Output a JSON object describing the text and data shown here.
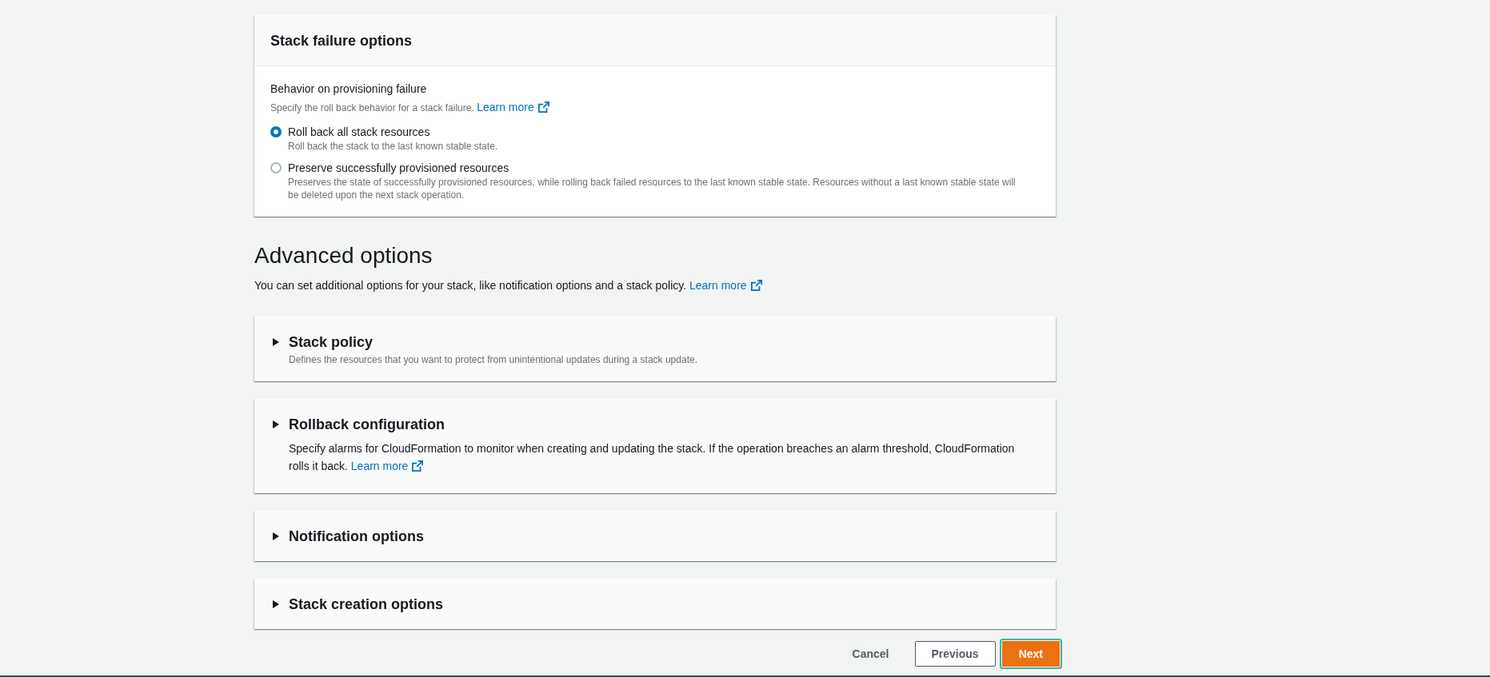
{
  "stack_failure_options": {
    "title": "Stack failure options",
    "field_label": "Behavior on provisioning failure",
    "field_description": "Specify the roll back behavior for a stack failure.",
    "learn_more": "Learn more",
    "options": [
      {
        "label": "Roll back all stack resources",
        "description": "Roll back the stack to the last known stable state.",
        "selected": true
      },
      {
        "label": "Preserve successfully provisioned resources",
        "description": "Preserves the state of successfully provisioned resources, while rolling back failed resources to the last known stable state. Resources without a last known stable state will be deleted upon the next stack operation.",
        "selected": false
      }
    ]
  },
  "advanced_options": {
    "title": "Advanced options",
    "description": "You can set additional options for your stack, like notification options and a stack policy.",
    "learn_more": "Learn more",
    "sections": [
      {
        "title": "Stack policy",
        "description": "Defines the resources that you want to protect from unintentional updates during a stack update.",
        "expanded": false
      },
      {
        "title": "Rollback configuration",
        "content": "Specify alarms for CloudFormation to monitor when creating and updating the stack. If the operation breaches an alarm threshold, CloudFormation rolls it back.",
        "learn_more": "Learn more",
        "expanded": false
      },
      {
        "title": "Notification options",
        "expanded": false
      },
      {
        "title": "Stack creation options",
        "expanded": false
      }
    ]
  },
  "actions": [
    {
      "label": "Cancel",
      "kind": "link",
      "focused": false
    },
    {
      "label": "Previous",
      "kind": "secondary",
      "focused": false
    },
    {
      "label": "Next",
      "kind": "primary",
      "focused": true
    }
  ]
}
